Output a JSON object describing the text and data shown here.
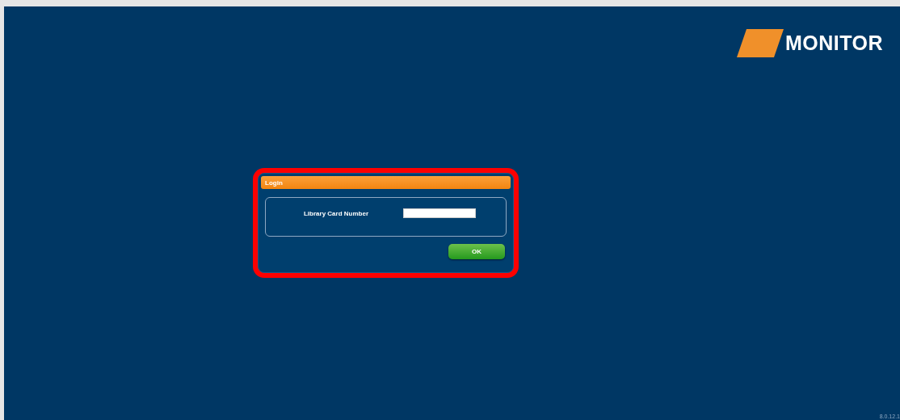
{
  "logo": {
    "text": "MONITOR"
  },
  "login_dialog": {
    "title": "Login",
    "highlighted": true,
    "fields": [
      {
        "label": "Library Card Number"
      }
    ],
    "buttons": [
      "OK"
    ]
  },
  "version": "8.0.12.1"
}
